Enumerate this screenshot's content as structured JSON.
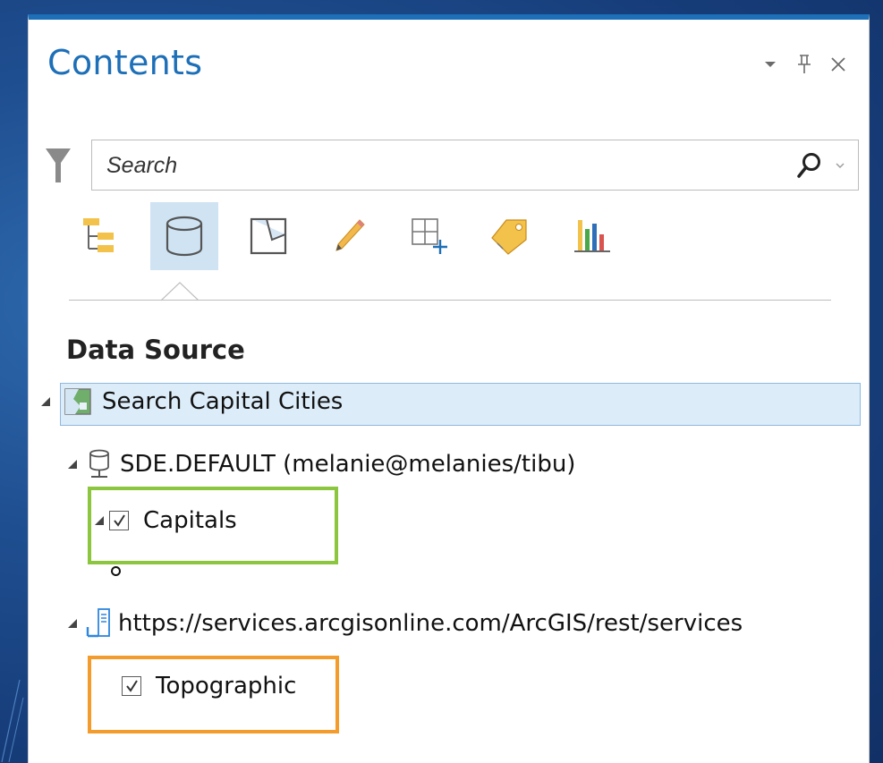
{
  "panel": {
    "title": "Contents",
    "controls": {
      "options": "▾",
      "pin": "⊥",
      "close": "✕"
    }
  },
  "search": {
    "placeholder": "Search"
  },
  "toolbar": {
    "tools": [
      {
        "icon": "drawing-order-icon",
        "active": false
      },
      {
        "icon": "data-source-icon",
        "active": true
      },
      {
        "icon": "selection-icon",
        "active": false
      },
      {
        "icon": "editing-icon",
        "active": false
      },
      {
        "icon": "snapping-icon",
        "active": false
      },
      {
        "icon": "labeling-icon",
        "active": false
      },
      {
        "icon": "charts-icon",
        "active": false
      }
    ]
  },
  "section": {
    "title": "Data Source"
  },
  "tree": {
    "map": {
      "label": "Search Capital Cities",
      "icon": "map-icon"
    },
    "database": {
      "label": "SDE.DEFAULT (melanie@melanies/tibu)",
      "icon": "database-icon"
    },
    "capitals": {
      "label": "Capitals",
      "checked": true
    },
    "service": {
      "label": "https://services.arcgisonline.com/ArcGIS/rest/services",
      "icon": "server-icon"
    },
    "topographic": {
      "label": "Topographic",
      "checked": true
    }
  },
  "colors": {
    "accent": "#1d6fb8",
    "highlight_green": "#8cc63f",
    "highlight_orange": "#f39c2c",
    "selection": "#dcecf9"
  }
}
